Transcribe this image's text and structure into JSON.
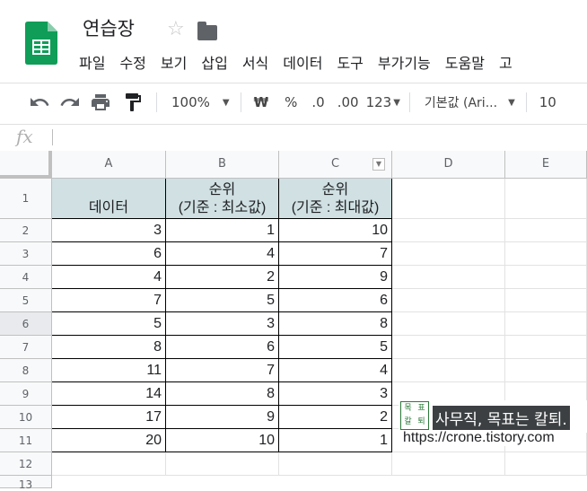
{
  "doc": {
    "title": "연습장"
  },
  "menu": [
    "파일",
    "수정",
    "보기",
    "삽입",
    "서식",
    "데이터",
    "도구",
    "부가기능",
    "도움말",
    "고"
  ],
  "toolbar": {
    "zoom": "100%",
    "currency": "₩",
    "percent": "%",
    "dec_decrease": ".0",
    "dec_increase": ".00",
    "number_format": "123",
    "font": "기본값 (Ari...",
    "font_size": "10"
  },
  "formula": {
    "fx": "fx",
    "value": ""
  },
  "columns": [
    "A",
    "B",
    "C",
    "D",
    "E"
  ],
  "rows": [
    "1",
    "2",
    "3",
    "4",
    "5",
    "6",
    "7",
    "8",
    "9",
    "10",
    "11",
    "12",
    "13"
  ],
  "table": {
    "headers": [
      [
        "",
        "데이터"
      ],
      [
        "순위",
        "(기준 : 최소값)"
      ],
      [
        "순위",
        "(기준 : 최대값)"
      ]
    ],
    "data": [
      [
        "3",
        "1",
        "10"
      ],
      [
        "6",
        "4",
        "7"
      ],
      [
        "4",
        "2",
        "9"
      ],
      [
        "7",
        "5",
        "6"
      ],
      [
        "5",
        "3",
        "8"
      ],
      [
        "8",
        "6",
        "5"
      ],
      [
        "11",
        "7",
        "4"
      ],
      [
        "14",
        "8",
        "3"
      ],
      [
        "17",
        "9",
        "2"
      ],
      [
        "20",
        "10",
        "1"
      ]
    ]
  },
  "watermark": {
    "logo_chars": [
      "목",
      "표",
      "칼",
      "퇴"
    ],
    "slogan": "사무직, 목표는 칼퇴.",
    "url": "https://crone.tistory.com"
  },
  "colors": {
    "header_fill": "#d0e0e3",
    "sheets_green": "#0f9d58"
  }
}
